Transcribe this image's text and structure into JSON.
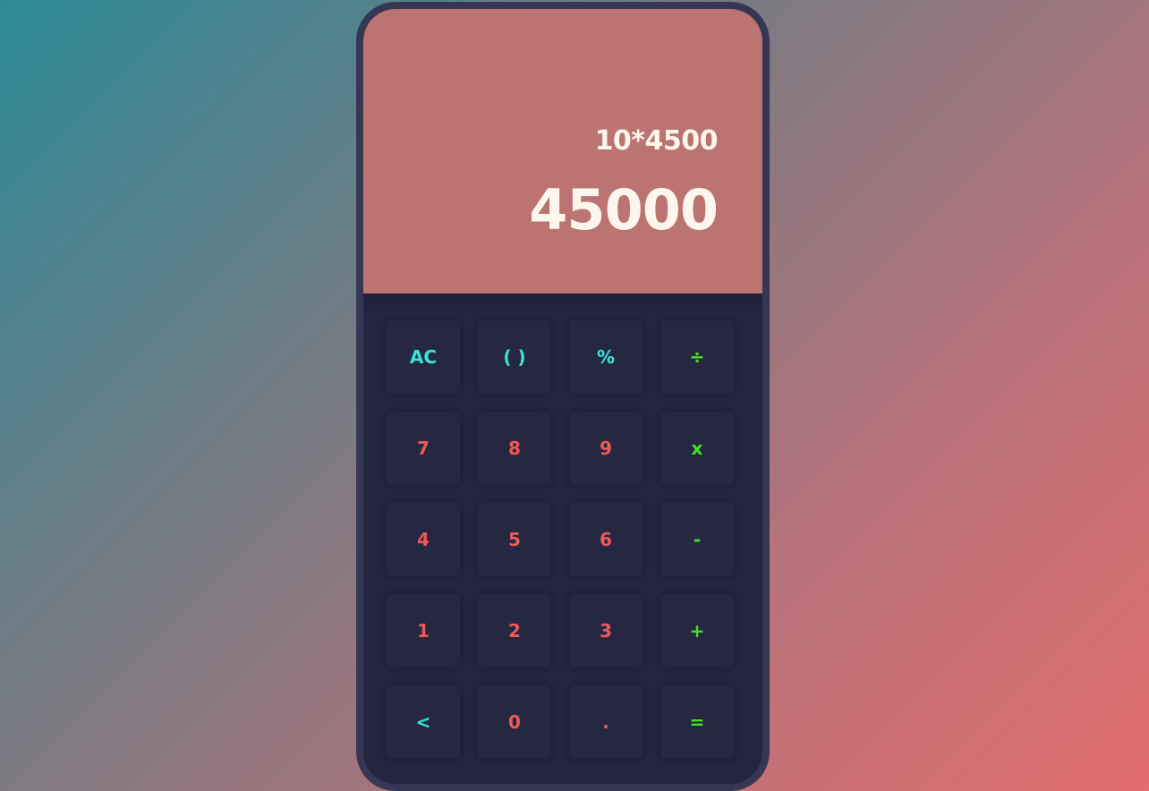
{
  "display": {
    "expression": "10*4500",
    "result": "45000"
  },
  "keys": [
    {
      "label": "AC",
      "name": "clear-button",
      "type": "func"
    },
    {
      "label": "( )",
      "name": "parentheses-button",
      "type": "func"
    },
    {
      "label": "%",
      "name": "percent-button",
      "type": "func"
    },
    {
      "label": "÷",
      "name": "divide-button",
      "type": "op"
    },
    {
      "label": "7",
      "name": "digit-7-button",
      "type": "num"
    },
    {
      "label": "8",
      "name": "digit-8-button",
      "type": "num"
    },
    {
      "label": "9",
      "name": "digit-9-button",
      "type": "num"
    },
    {
      "label": "x",
      "name": "multiply-button",
      "type": "op"
    },
    {
      "label": "4",
      "name": "digit-4-button",
      "type": "num"
    },
    {
      "label": "5",
      "name": "digit-5-button",
      "type": "num"
    },
    {
      "label": "6",
      "name": "digit-6-button",
      "type": "num"
    },
    {
      "label": "-",
      "name": "subtract-button",
      "type": "op"
    },
    {
      "label": "1",
      "name": "digit-1-button",
      "type": "num"
    },
    {
      "label": "2",
      "name": "digit-2-button",
      "type": "num"
    },
    {
      "label": "3",
      "name": "digit-3-button",
      "type": "num"
    },
    {
      "label": "+",
      "name": "add-button",
      "type": "op"
    },
    {
      "label": "<",
      "name": "backspace-button",
      "type": "func"
    },
    {
      "label": "0",
      "name": "digit-0-button",
      "type": "num"
    },
    {
      "label": ".",
      "name": "decimal-button",
      "type": "num"
    },
    {
      "label": "=",
      "name": "equals-button",
      "type": "op"
    }
  ],
  "colors": {
    "display_bg": "#bb7472",
    "keypad_bg": "#232541",
    "function_key": "#39e6d6",
    "number_key": "#ee5a55",
    "operator_key": "#44e323"
  }
}
